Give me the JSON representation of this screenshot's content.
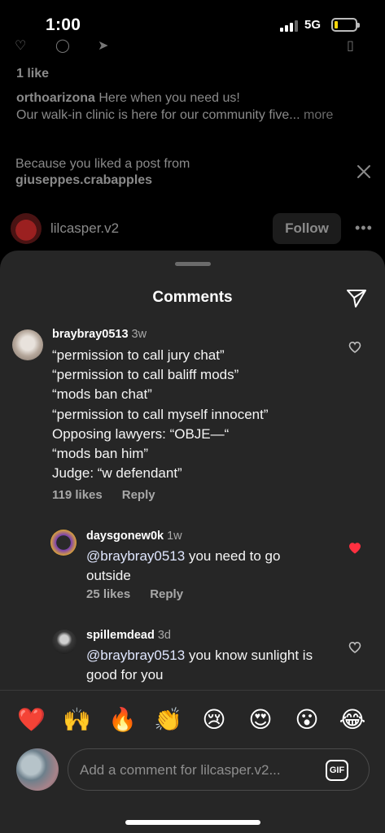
{
  "status_bar": {
    "time": "1:00",
    "network": "5G",
    "battery_level": 0.15,
    "battery_color": "#ffd60a"
  },
  "feed": {
    "likes": "1 like",
    "caption": {
      "username": "orthoarizona",
      "line1": " Here when you need us!",
      "line2": "Our walk-in clinic is here for our community five...",
      "more": " more"
    },
    "suggestion": {
      "line1": "Because you liked a post from",
      "account": "giuseppes.crabapples"
    },
    "next_post": {
      "username": "lilcasper.v2",
      "follow_label": "Follow",
      "menu_label": "•••"
    }
  },
  "sheet": {
    "title": "Comments"
  },
  "comments": [
    {
      "username": "braybray0513",
      "time": "3w",
      "lines": [
        "“permission to call jury chat”",
        "“permission to call baliff mods”",
        "“mods ban chat”",
        "“permission to call myself innocent”",
        "Opposing lawyers: “OBJE—“",
        "“mods ban him”",
        "Judge: “w defendant”"
      ],
      "likes": "119 likes",
      "reply": "Reply",
      "liked": false
    },
    {
      "username": "daysgonew0k",
      "time": "1w",
      "mention": "@braybray0513",
      "text1": " you need to go",
      "text2": "outside",
      "likes": "25 likes",
      "reply": "Reply",
      "liked": true,
      "liked_color": "#ff3040"
    },
    {
      "username": "spillemdead",
      "time": "3d",
      "mention": "@braybray0513",
      "text1": " you know sunlight is",
      "text2": "good for you",
      "liked": false
    }
  ],
  "emoji_bar": [
    "❤️",
    "🙌",
    "🔥",
    "👏",
    "😢",
    "😍",
    "😮",
    "😂"
  ],
  "composer": {
    "placeholder": "Add a comment for lilcasper.v2...",
    "gif_label": "GIF"
  }
}
